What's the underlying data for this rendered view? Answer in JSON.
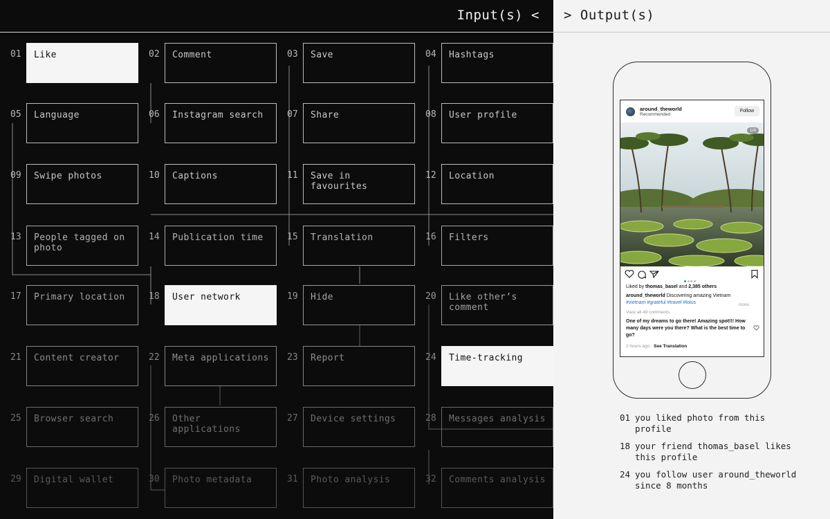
{
  "header": {
    "input_title": "Input(s) <",
    "output_title": "> Output(s)"
  },
  "cells": [
    {
      "num": "01",
      "label": "Like",
      "active": true,
      "tier": 0
    },
    {
      "num": "02",
      "label": "Comment",
      "active": false,
      "tier": 0
    },
    {
      "num": "03",
      "label": "Save",
      "active": false,
      "tier": 0
    },
    {
      "num": "04",
      "label": "Hashtags",
      "active": false,
      "tier": 0
    },
    {
      "num": "05",
      "label": "Language",
      "active": false,
      "tier": 0
    },
    {
      "num": "06",
      "label": "Instagram search",
      "active": false,
      "tier": 0
    },
    {
      "num": "07",
      "label": "Share",
      "active": false,
      "tier": 0
    },
    {
      "num": "08",
      "label": "User profile",
      "active": false,
      "tier": 0
    },
    {
      "num": "09",
      "label": "Swipe photos",
      "active": false,
      "tier": 0
    },
    {
      "num": "10",
      "label": "Captions",
      "active": false,
      "tier": 0
    },
    {
      "num": "11",
      "label": "Save in favourites",
      "active": false,
      "tier": 0
    },
    {
      "num": "12",
      "label": "Location",
      "active": false,
      "tier": 0
    },
    {
      "num": "13",
      "label": "People tagged on photo",
      "active": false,
      "tier": 1
    },
    {
      "num": "14",
      "label": "Publication time",
      "active": false,
      "tier": 1
    },
    {
      "num": "15",
      "label": "Translation",
      "active": false,
      "tier": 1
    },
    {
      "num": "16",
      "label": "Filters",
      "active": false,
      "tier": 1
    },
    {
      "num": "17",
      "label": "Primary location",
      "active": false,
      "tier": 2
    },
    {
      "num": "18",
      "label": "User network",
      "active": true,
      "tier": 2
    },
    {
      "num": "19",
      "label": "Hide",
      "active": false,
      "tier": 2
    },
    {
      "num": "20",
      "label": "Like other’s comment",
      "active": false,
      "tier": 2
    },
    {
      "num": "21",
      "label": "Content creator",
      "active": false,
      "tier": 3
    },
    {
      "num": "22",
      "label": "Meta applications",
      "active": false,
      "tier": 3
    },
    {
      "num": "23",
      "label": "Report",
      "active": false,
      "tier": 3
    },
    {
      "num": "24",
      "label": "Time-tracking",
      "active": true,
      "tier": 3
    },
    {
      "num": "25",
      "label": "Browser search",
      "active": false,
      "tier": 4
    },
    {
      "num": "26",
      "label": "Other applications",
      "active": false,
      "tier": 4
    },
    {
      "num": "27",
      "label": "Device settings",
      "active": false,
      "tier": 4
    },
    {
      "num": "28",
      "label": "Messages analysis",
      "active": false,
      "tier": 4
    },
    {
      "num": "29",
      "label": "Digital wallet",
      "active": false,
      "tier": 5
    },
    {
      "num": "30",
      "label": "Photo metadata",
      "active": false,
      "tier": 5
    },
    {
      "num": "31",
      "label": "Photo analysis",
      "active": false,
      "tier": 5
    },
    {
      "num": "32",
      "label": "Comments analysis",
      "active": false,
      "tier": 5
    }
  ],
  "tier_colors": {
    "num": [
      "#b8b8b8",
      "#a8a8a8",
      "#9a9a9a",
      "#888888",
      "#6d6d6d",
      "#595959"
    ],
    "border": [
      "#bdbdbd",
      "#ababab",
      "#9a9a9a",
      "#858585",
      "#6a6a6a",
      "#555555"
    ],
    "text": [
      "#c8c8c8",
      "#b5b5b5",
      "#a3a3a3",
      "#8e8e8e",
      "#707070",
      "#5a5a5a"
    ]
  },
  "post": {
    "username": "around_theworld",
    "subtitle": "Recommended",
    "follow_label": "Follow",
    "photo_counter": "1/4",
    "likes_prefix": "Liked by ",
    "likes_user": "thomas_basel",
    "likes_mid": " and ",
    "likes_count": "2,385 others",
    "caption_user": "around_theworld",
    "caption_text": " Discovering amazing Vietnam",
    "caption_tags": "#vietnam #grateful #travel #lotus",
    "more_label": "more",
    "view_comments": "View all 49 comments",
    "comment_text": "One of my dreams to go there! Amazing spot!!! How many days were you there? What is the best time to go?",
    "time_ago": "2 hours ago",
    "separator": " · ",
    "see_translation": "See Translation"
  },
  "outputs": [
    {
      "num": "01",
      "text": "you liked photo from this profile"
    },
    {
      "num": "18",
      "text": "your friend thomas_basel likes this profile"
    },
    {
      "num": "24",
      "text": "you follow user around_theworld since 8 months"
    }
  ]
}
